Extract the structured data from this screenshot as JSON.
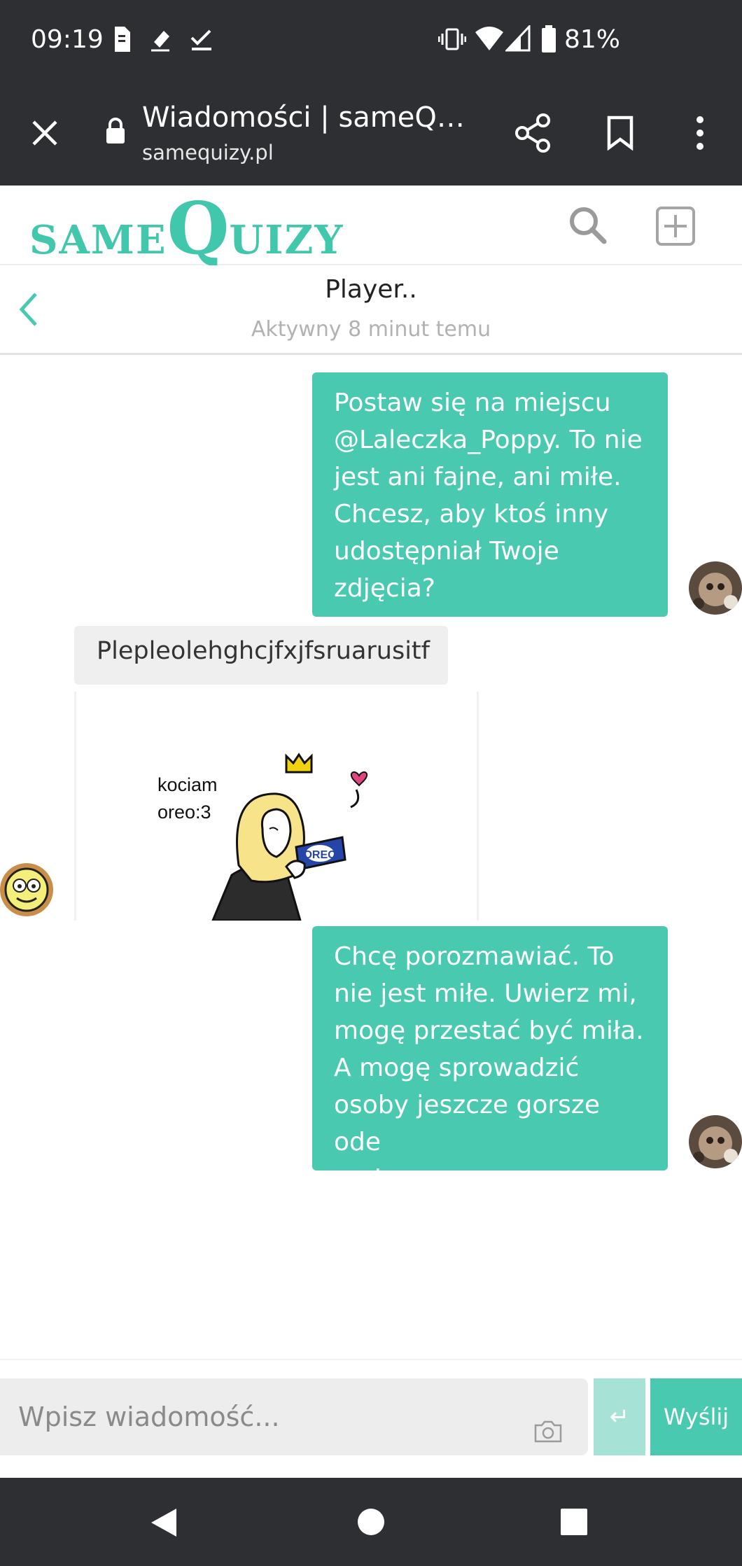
{
  "status_bar": {
    "time": "09:19",
    "battery_percent": "81%",
    "icons": [
      "sim-card-icon",
      "draw-icon",
      "check-icon",
      "vibrate-icon",
      "wifi-icon",
      "signal-icon",
      "battery-icon"
    ]
  },
  "browser": {
    "title": "Wiadomości | sameQui…",
    "url": "samequizy.pl",
    "icons": [
      "close-icon",
      "lock-icon",
      "share-icon",
      "bookmark-icon",
      "more-icon"
    ]
  },
  "site": {
    "logo_parts": [
      "SAME",
      "Q",
      "UIZY"
    ],
    "icons": [
      "search-icon",
      "add-icon"
    ]
  },
  "chat": {
    "name": "Player..",
    "status": "Aktywny 8 minut temu",
    "messages": [
      {
        "direction": "outgoing",
        "lines": [
          "Postaw się na miejscu",
          "@Laleczka_Poppy. To nie",
          "jest ani fajne, ani miłe.",
          "Chcesz, aby ktoś inny",
          "udostępniał Twoje",
          "zdjęcia?"
        ]
      },
      {
        "direction": "incoming",
        "text": "Plepleolehghcjfxjfsruarusitf"
      },
      {
        "direction": "incoming",
        "type": "image",
        "caption_lines": [
          "kociam",
          "oreo:3"
        ],
        "cookie_text": "OREO"
      },
      {
        "direction": "outgoing",
        "lines": [
          "Chcę porozmawiać. To",
          "nie jest miłe. Uwierz mi,",
          "mogę przestać być miła.",
          "A mogę sprowadzić",
          "osoby jeszcze gorsze ode",
          "mnie"
        ]
      }
    ]
  },
  "composer": {
    "placeholder": "Wpisz wiadomość...",
    "enter_symbol": "↵",
    "send_label": "Wyślij"
  },
  "colors": {
    "accent": "#48c9b0",
    "logo": "#41c7ac",
    "bar_dark": "#2e2f33",
    "incoming_bubble": "#efefef"
  }
}
